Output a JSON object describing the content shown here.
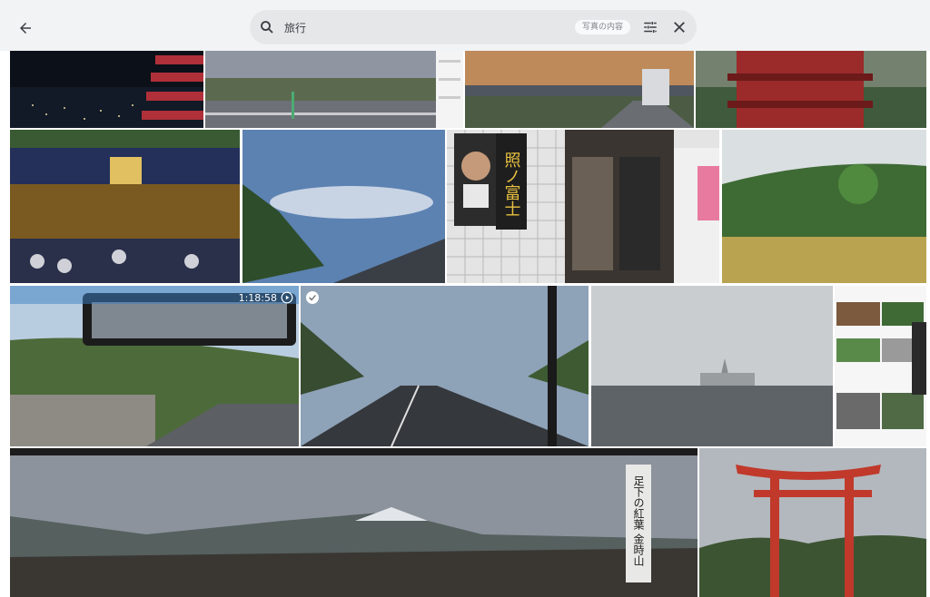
{
  "search": {
    "query": "旅行",
    "chip_label": "写真の内容"
  },
  "icons": {
    "back": "arrow-back-icon",
    "search": "search-icon",
    "tune": "tune-icon",
    "close": "close-icon",
    "play": "play-icon",
    "check": "check-icon"
  },
  "photos": {
    "video_duration": "1:18:58",
    "sumo_banner_text": "照ノ富士",
    "stone_marker_text": "足下の紅葉 金時山"
  },
  "colors": {
    "topbar": "#f1f3f4",
    "searchbox": "#e6e7e9",
    "torii": "#c0392b"
  }
}
